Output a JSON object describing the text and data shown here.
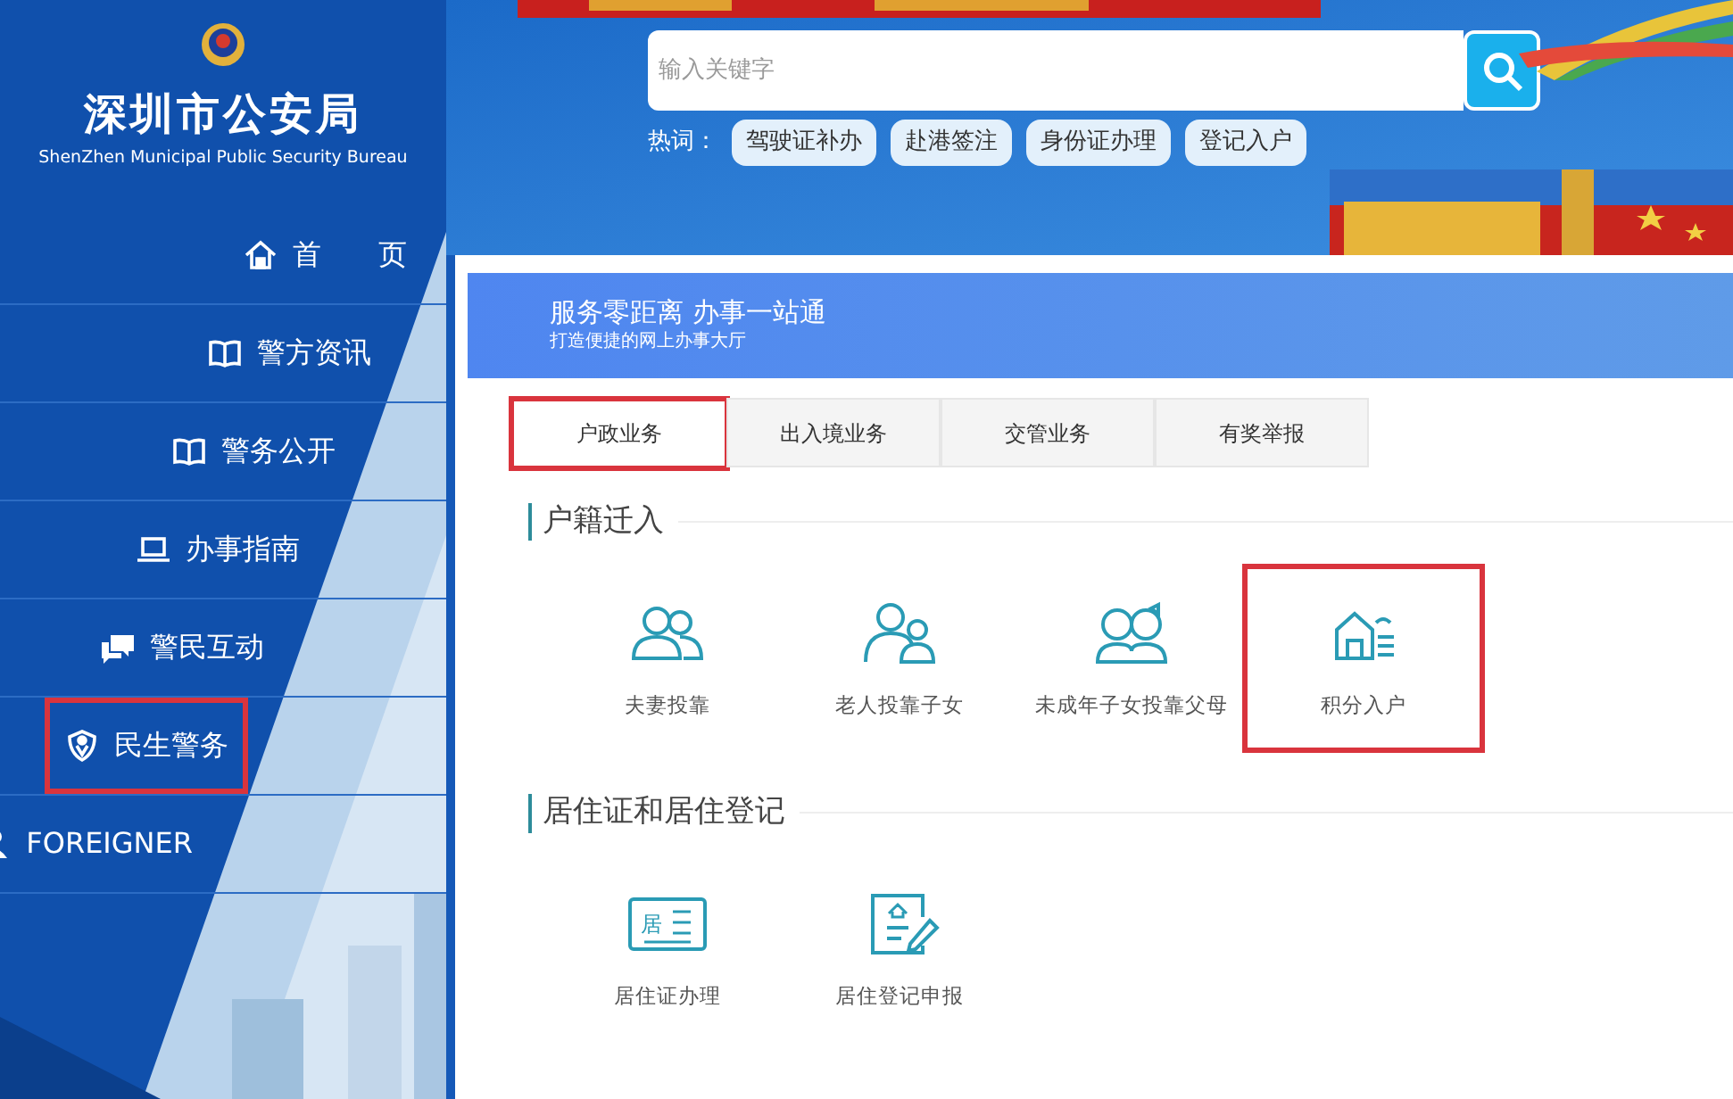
{
  "logo": {
    "title": "深圳市公安局",
    "subtitle": "ShenZhen Municipal Public Security Bureau"
  },
  "nav": [
    {
      "label": "首　　页",
      "kind": "home",
      "highlighted": false
    },
    {
      "label": "警方资讯",
      "kind": "book",
      "highlighted": false
    },
    {
      "label": "警务公开",
      "kind": "book",
      "highlighted": false
    },
    {
      "label": "办事指南",
      "kind": "laptop",
      "highlighted": false
    },
    {
      "label": "警民互动",
      "kind": "chat",
      "highlighted": false
    },
    {
      "label": "民生警务",
      "kind": "shield",
      "highlighted": true
    },
    {
      "label": "FOREIGNER",
      "kind": "person",
      "highlighted": false
    }
  ],
  "search": {
    "placeholder": "输入关键字"
  },
  "hot_words": {
    "label": "热词：",
    "items": [
      "驾驶证补办",
      "赴港签注",
      "身份证办理",
      "登记入户"
    ]
  },
  "banner": {
    "title": "服务零距离 办事一站通",
    "subtitle": "打造便捷的网上办事大厅"
  },
  "tabs": [
    {
      "label": "户政业务",
      "selected": true,
      "highlighted": true
    },
    {
      "label": "出入境业务",
      "selected": false,
      "highlighted": false
    },
    {
      "label": "交管业务",
      "selected": false,
      "highlighted": false
    },
    {
      "label": "有奖举报",
      "selected": false,
      "highlighted": false
    }
  ],
  "sections": [
    {
      "title": "户籍迁入",
      "items": [
        {
          "label": "夫妻投靠",
          "kind": "couple",
          "highlighted": false
        },
        {
          "label": "老人投靠子女",
          "kind": "elder",
          "highlighted": false
        },
        {
          "label": "未成年子女投靠父母",
          "kind": "kids",
          "highlighted": false
        },
        {
          "label": "积分入户",
          "kind": "house",
          "highlighted": true
        }
      ]
    },
    {
      "title": "居住证和居住登记",
      "items": [
        {
          "label": "居住证办理",
          "kind": "card",
          "icon_text": "居",
          "highlighted": false
        },
        {
          "label": "居住登记申报",
          "kind": "form",
          "highlighted": false
        }
      ]
    }
  ]
}
